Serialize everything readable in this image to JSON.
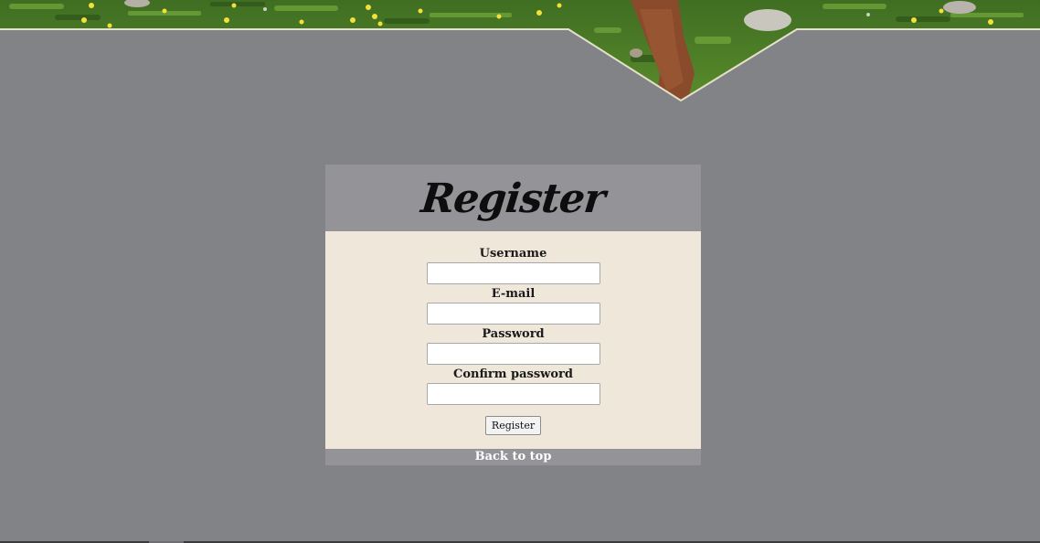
{
  "banner": {
    "image_name": "grass-trail-photo"
  },
  "register": {
    "title": "Register",
    "fields": [
      {
        "label": "Username",
        "value": "",
        "placeholder": ""
      },
      {
        "label": "E-mail",
        "value": "",
        "placeholder": ""
      },
      {
        "label": "Password",
        "value": "",
        "placeholder": ""
      },
      {
        "label": "Confirm password",
        "value": "",
        "placeholder": ""
      }
    ],
    "submit_label": "Register"
  },
  "footer": {
    "back_to_top_label": "Back to top"
  },
  "colors": {
    "page_background": "#828387",
    "panel_header": "#949498",
    "panel_body": "#f0e7db",
    "back_to_top_bar": "#949498"
  }
}
